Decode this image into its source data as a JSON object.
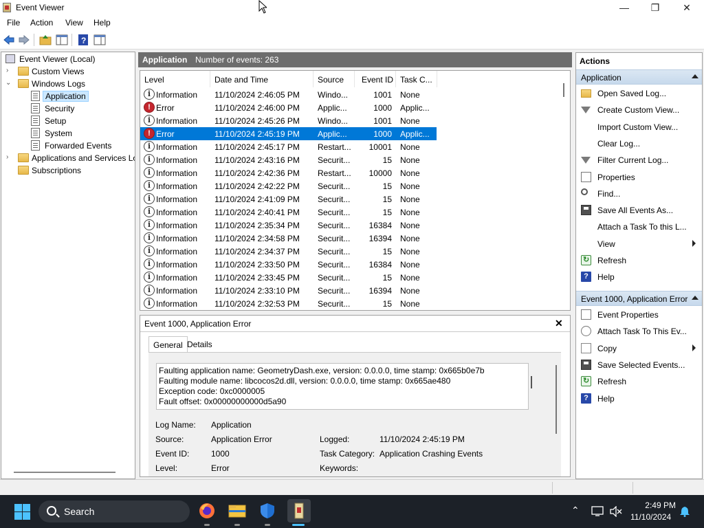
{
  "window": {
    "title": "Event Viewer",
    "controls": {
      "minimize": "—",
      "restore": "❐",
      "close": "✕"
    }
  },
  "menu": [
    "File",
    "Action",
    "View",
    "Help"
  ],
  "tree": {
    "root": "Event Viewer (Local)",
    "custom_views": "Custom Views",
    "windows_logs": "Windows Logs",
    "logs": [
      "Application",
      "Security",
      "Setup",
      "System",
      "Forwarded Events"
    ],
    "apps_services": "Applications and Services Lo",
    "subscriptions": "Subscriptions"
  },
  "center": {
    "log_name": "Application",
    "count_label": "Number of events: 263",
    "columns": [
      "Level",
      "Date and Time",
      "Source",
      "Event ID",
      "Task C..."
    ],
    "rows": [
      {
        "level": "Information",
        "date": "11/10/2024 2:46:05 PM",
        "source": "Windo...",
        "id": "1001",
        "task": "None",
        "type": "info"
      },
      {
        "level": "Error",
        "date": "11/10/2024 2:46:00 PM",
        "source": "Applic...",
        "id": "1000",
        "task": "Applic...",
        "type": "error"
      },
      {
        "level": "Information",
        "date": "11/10/2024 2:45:26 PM",
        "source": "Windo...",
        "id": "1001",
        "task": "None",
        "type": "info"
      },
      {
        "level": "Error",
        "date": "11/10/2024 2:45:19 PM",
        "source": "Applic...",
        "id": "1000",
        "task": "Applic...",
        "type": "error",
        "selected": true
      },
      {
        "level": "Information",
        "date": "11/10/2024 2:45:17 PM",
        "source": "Restart...",
        "id": "10001",
        "task": "None",
        "type": "info"
      },
      {
        "level": "Information",
        "date": "11/10/2024 2:43:16 PM",
        "source": "Securit...",
        "id": "15",
        "task": "None",
        "type": "info"
      },
      {
        "level": "Information",
        "date": "11/10/2024 2:42:36 PM",
        "source": "Restart...",
        "id": "10000",
        "task": "None",
        "type": "info"
      },
      {
        "level": "Information",
        "date": "11/10/2024 2:42:22 PM",
        "source": "Securit...",
        "id": "15",
        "task": "None",
        "type": "info"
      },
      {
        "level": "Information",
        "date": "11/10/2024 2:41:09 PM",
        "source": "Securit...",
        "id": "15",
        "task": "None",
        "type": "info"
      },
      {
        "level": "Information",
        "date": "11/10/2024 2:40:41 PM",
        "source": "Securit...",
        "id": "15",
        "task": "None",
        "type": "info"
      },
      {
        "level": "Information",
        "date": "11/10/2024 2:35:34 PM",
        "source": "Securit...",
        "id": "16384",
        "task": "None",
        "type": "info"
      },
      {
        "level": "Information",
        "date": "11/10/2024 2:34:58 PM",
        "source": "Securit...",
        "id": "16394",
        "task": "None",
        "type": "info"
      },
      {
        "level": "Information",
        "date": "11/10/2024 2:34:37 PM",
        "source": "Securit...",
        "id": "15",
        "task": "None",
        "type": "info"
      },
      {
        "level": "Information",
        "date": "11/10/2024 2:33:50 PM",
        "source": "Securit...",
        "id": "16384",
        "task": "None",
        "type": "info"
      },
      {
        "level": "Information",
        "date": "11/10/2024 2:33:45 PM",
        "source": "Securit...",
        "id": "15",
        "task": "None",
        "type": "info"
      },
      {
        "level": "Information",
        "date": "11/10/2024 2:33:10 PM",
        "source": "Securit...",
        "id": "16394",
        "task": "None",
        "type": "info"
      },
      {
        "level": "Information",
        "date": "11/10/2024 2:32:53 PM",
        "source": "Securit...",
        "id": "15",
        "task": "None",
        "type": "info"
      }
    ]
  },
  "detail": {
    "title": "Event 1000, Application Error",
    "close": "✕",
    "tabs": [
      "General",
      "Details"
    ],
    "description": [
      "Faulting application name: GeometryDash.exe, version: 0.0.0.0, time stamp: 0x665b0e7b",
      "Faulting module name: libcocos2d.dll, version: 0.0.0.0, time stamp: 0x665ae480",
      "Exception code: 0xc0000005",
      "Fault offset: 0x00000000000d5a90"
    ],
    "log_name_label": "Log Name:",
    "log_name_value": "Application",
    "source_label": "Source:",
    "source_value": "Application Error",
    "logged_label": "Logged:",
    "logged_value": "11/10/2024 2:45:19 PM",
    "event_id_label": "Event ID:",
    "event_id_value": "1000",
    "task_cat_label": "Task Category:",
    "task_cat_value": "Application Crashing Events",
    "level_label": "Level:",
    "level_value": "Error",
    "keywords_label": "Keywords:"
  },
  "actions": {
    "title": "Actions",
    "section1": "Application",
    "items1": [
      {
        "label": "Open Saved Log...",
        "icon": "folder-icon"
      },
      {
        "label": "Create Custom View...",
        "icon": "filter-icon"
      },
      {
        "label": "Import Custom View...",
        "icon": ""
      },
      {
        "label": "Clear Log...",
        "icon": ""
      },
      {
        "label": "Filter Current Log...",
        "icon": "filter-icon"
      },
      {
        "label": "Properties",
        "icon": "properties-icon"
      },
      {
        "label": "Find...",
        "icon": "find-icon"
      },
      {
        "label": "Save All Events As...",
        "icon": "save-icon"
      },
      {
        "label": "Attach a Task To this L...",
        "icon": ""
      },
      {
        "label": "View",
        "icon": "",
        "submenu": true
      },
      {
        "label": "Refresh",
        "icon": "refresh-icon"
      },
      {
        "label": "Help",
        "icon": "help-icon",
        "submenu": true
      }
    ],
    "section2": "Event 1000, Application Error",
    "items2": [
      {
        "label": "Event Properties",
        "icon": "properties-icon"
      },
      {
        "label": "Attach Task To This Ev...",
        "icon": "clock-icon"
      },
      {
        "label": "Copy",
        "icon": "copy-icon",
        "submenu": true
      },
      {
        "label": "Save Selected Events...",
        "icon": "save-icon"
      },
      {
        "label": "Refresh",
        "icon": "refresh-icon"
      },
      {
        "label": "Help",
        "icon": "help-icon",
        "submenu": true
      }
    ]
  },
  "taskbar": {
    "search_placeholder": "Search",
    "time": "2:49 PM",
    "date": "11/10/2024"
  },
  "colors": {
    "selection": "#0078d7",
    "header_bar": "#6d6d6d",
    "section_band": "#c7d9ec",
    "taskbar": "#1c2128",
    "error_red": "#c4262e"
  }
}
